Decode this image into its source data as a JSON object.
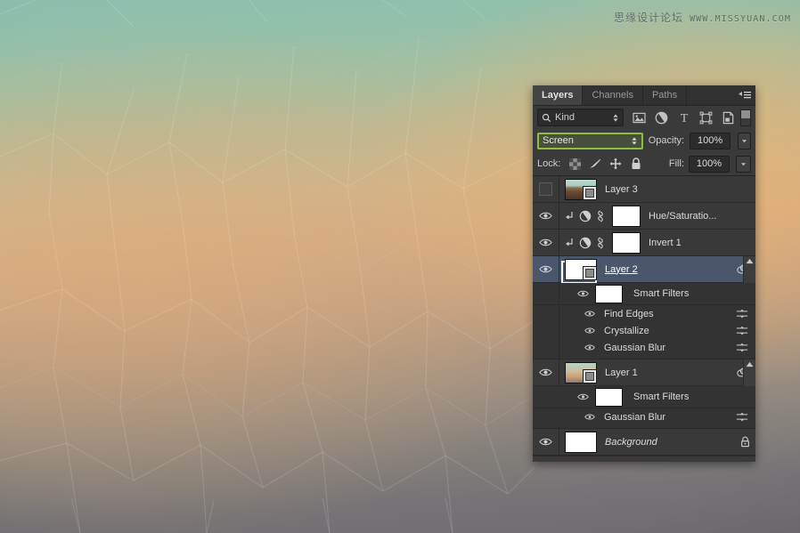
{
  "watermark": {
    "chinese": "思缘设计论坛",
    "url": "WWW.MISSYUAN.COM"
  },
  "panel": {
    "tabs": [
      {
        "label": "Layers",
        "active": true
      },
      {
        "label": "Channels",
        "active": false
      },
      {
        "label": "Paths",
        "active": false
      }
    ],
    "menu_icon": "panel-menu-icon",
    "filter": {
      "kind_label": "Kind",
      "search_icon": "search-icon",
      "type_icons": [
        "pixel-layer-filter-icon",
        "adjustment-layer-filter-icon",
        "type-layer-filter-icon",
        "shape-layer-filter-icon",
        "smart-object-filter-icon"
      ],
      "toggle_icon": "filter-toggle-switch"
    },
    "blend": {
      "mode": "Screen",
      "opacity_label": "Opacity:",
      "opacity_value": "100%",
      "highlight_color": "#8fbf3f"
    },
    "lock": {
      "label": "Lock:",
      "icons": [
        "lock-transparent-pixels-icon",
        "lock-image-pixels-icon",
        "lock-position-icon",
        "lock-all-icon"
      ],
      "fill_label": "Fill:",
      "fill_value": "100%"
    },
    "layers": [
      {
        "name": "Layer 3",
        "visible": false,
        "thumb": "photo-landscape",
        "smart_object": true,
        "selected": false,
        "type": "smart-object"
      },
      {
        "name": "Hue/Saturatio...",
        "visible": true,
        "clipped": true,
        "thumb": "white-mask",
        "selected": false,
        "type": "adjustment",
        "linked": true
      },
      {
        "name": "Invert 1",
        "visible": true,
        "clipped": true,
        "thumb": "white-mask",
        "selected": false,
        "type": "adjustment",
        "linked": true
      },
      {
        "name": "Layer 2",
        "visible": true,
        "thumb": "white",
        "smart_object": true,
        "selected": true,
        "type": "smart-object",
        "has_smart_filters": true,
        "smart_filters": {
          "group_label": "Smart Filters",
          "group_visible": true,
          "items": [
            {
              "name": "Find Edges",
              "visible": true
            },
            {
              "name": "Crystallize",
              "visible": true
            },
            {
              "name": "Gaussian Blur",
              "visible": true
            }
          ]
        }
      },
      {
        "name": "Layer 1",
        "visible": true,
        "thumb": "photo-gradient",
        "smart_object": true,
        "selected": false,
        "type": "smart-object",
        "has_smart_filters": true,
        "smart_filters": {
          "group_label": "Smart Filters",
          "group_visible": true,
          "items": [
            {
              "name": "Gaussian Blur",
              "visible": true
            }
          ]
        }
      },
      {
        "name": "Background",
        "visible": true,
        "thumb": "white",
        "selected": false,
        "type": "background",
        "locked": true,
        "italic": true
      }
    ]
  }
}
